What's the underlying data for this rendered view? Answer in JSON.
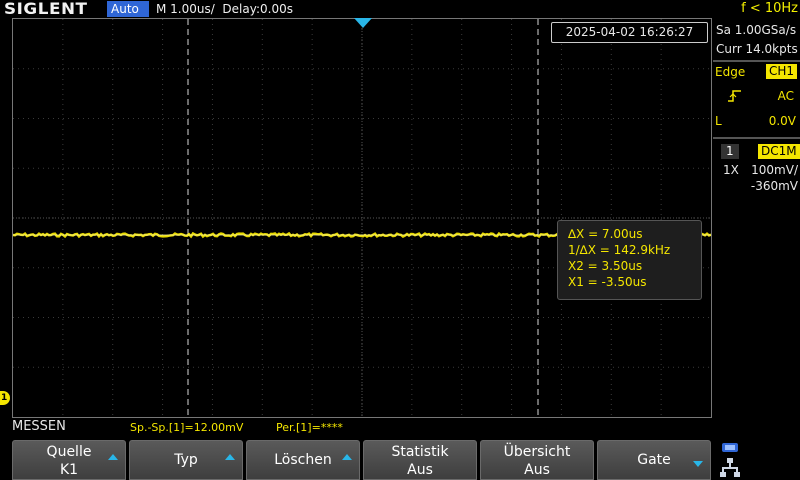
{
  "header": {
    "brand": "SIGLENT",
    "trigger_mode": "Auto",
    "timebase": "M 1.00us/  Delay:0.00s",
    "frequency": "f < 10Hz"
  },
  "screen": {
    "timestamp": "2025-04-02 16:26:27",
    "channel_marker": "1",
    "cursor_readout": {
      "delta_x": "∆X = 7.00us",
      "inv_delta_x": "1/∆X = 142.9kHz",
      "x2": "X2 = 3.50us",
      "x1": "X1 = -3.50us"
    }
  },
  "acquisition": {
    "sample_rate": "Sa 1.00GSa/s",
    "memory": "Curr 14.0kpts"
  },
  "trigger": {
    "type": "Edge",
    "source": "CH1",
    "coupling": "AC",
    "level_label": "L",
    "level": "0.0V"
  },
  "channel": {
    "number": "1",
    "coupling": "DC1M",
    "probe": "1X",
    "scale": "100mV/",
    "offset": "-360mV"
  },
  "measure": {
    "title": "MESSEN",
    "item1": "Sp.-Sp.[1]=12.00mV",
    "item2": "Per.[1]=****"
  },
  "softkeys": [
    {
      "line1": "Quelle",
      "line2": "K1"
    },
    {
      "line1": "Typ"
    },
    {
      "line1": "Löschen"
    },
    {
      "line1": "Statistik",
      "line2": "Aus"
    },
    {
      "line1": "Übersicht",
      "line2": "Aus"
    },
    {
      "line1": "Gate"
    }
  ],
  "colors": {
    "trace": "#f4e600",
    "accent": "#29b6e8",
    "mode_badge": "#2f66d6"
  }
}
